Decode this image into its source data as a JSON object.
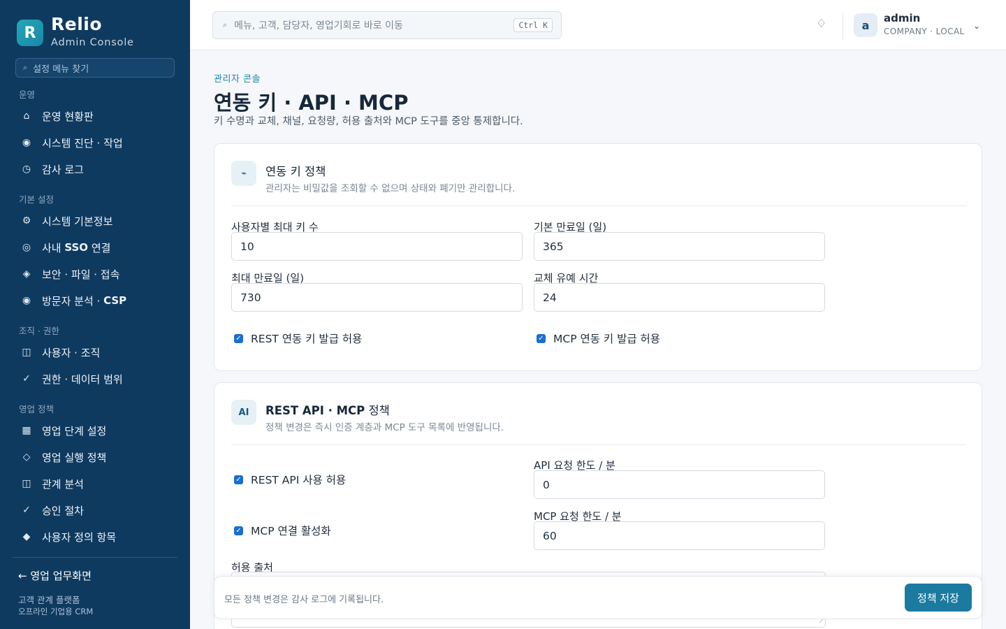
{
  "sidebar": {
    "brand": {
      "logo_letter": "R",
      "name": "Relio",
      "subtitle": "Admin Console"
    },
    "search_placeholder": "설정 메뉴 찾기",
    "groups": [
      {
        "label": "운영"
      },
      {
        "label": "기본 설정"
      },
      {
        "label": "조직 · 권한"
      },
      {
        "label": "영업 정책"
      }
    ],
    "items": [
      {
        "icon": "⌂",
        "icon_name": "home-icon",
        "label": "운영 현황판"
      },
      {
        "icon": "◉",
        "icon_name": "diagnostic-icon",
        "label": "시스템 진단 · 작업"
      },
      {
        "icon": "◷",
        "icon_name": "clock-icon",
        "label": "감사 로그"
      },
      {
        "icon": "⚙",
        "icon_name": "gear-icon",
        "label": "시스템 기본정보"
      },
      {
        "icon": "◎",
        "icon_name": "sso-icon",
        "label_pre": "사내 ",
        "label_bold": "SSO",
        "label_post": " 연결"
      },
      {
        "icon": "◈",
        "icon_name": "shield-icon",
        "label": "보안 · 파일 · 접속"
      },
      {
        "icon": "◉",
        "icon_name": "analytics-icon",
        "label_pre": "방문자 분석 · ",
        "label_bold": "CSP",
        "label_post": ""
      },
      {
        "icon": "◫",
        "icon_name": "users-icon",
        "label": "사용자 · 조직"
      },
      {
        "icon": "✓",
        "icon_name": "check-icon",
        "label": "권한 · 데이터 범위"
      },
      {
        "icon": "▦",
        "icon_name": "grid-icon",
        "label": "영업 단계 설정"
      },
      {
        "icon": "◇",
        "icon_name": "diamond-outline-icon",
        "label": "영업 실행 정책"
      },
      {
        "icon": "◫",
        "icon_name": "relation-icon",
        "label": "관계 분석"
      },
      {
        "icon": "✓",
        "icon_name": "approval-icon",
        "label": "승인 절차"
      },
      {
        "icon": "◆",
        "icon_name": "diamond-filled-icon",
        "label": "사용자 정의 항목"
      }
    ],
    "back_link": "← 영업 업무화면",
    "footer_line1": "고객 관계 플랫폼",
    "footer_line2": "오프라인 기업용 CRM"
  },
  "topbar": {
    "search_placeholder": "메뉴, 고객, 담당자, 영업기회로 바로 이동",
    "shortcut": "Ctrl K",
    "user": {
      "avatar_letter": "a",
      "name": "admin",
      "org": "COMPANY · LOCAL"
    }
  },
  "page": {
    "breadcrumb": "관리자 콘솔",
    "title_plain": "연동 키 · ",
    "title_bold": "API · MCP",
    "description": "키 수명과 교체, 채널, 요청량, 허용 출처와 MCP 도구를 중앙 통제합니다."
  },
  "card_keys": {
    "icon": "⌁",
    "title": "연동 키 정책",
    "subtitle": "관리자는 비밀값을 조회할 수 없으며 상태와 폐기만 관리합니다.",
    "fields": {
      "max_keys": {
        "label": "사용자별 최대 키 수",
        "value": "10"
      },
      "default_expiry": {
        "label": "기본 만료일 (일)",
        "value": "365"
      },
      "max_expiry": {
        "label": "최대 만료일 (일)",
        "value": "730"
      },
      "grace_period": {
        "label": "교체 유예 시간",
        "value": "24"
      }
    },
    "checkboxes": {
      "rest_issue": {
        "label": "REST 연동 키 발급 허용",
        "checked": true
      },
      "mcp_issue": {
        "label": "MCP 연동 키 발급 허용",
        "checked": true
      }
    }
  },
  "card_api": {
    "icon": "AI",
    "title_bold": "REST API · MCP",
    "title_plain": " 정책",
    "subtitle": "정책 변경은 즉시 인증 계층과 MCP 도구 목록에 반영됩니다.",
    "checkboxes": {
      "rest_enabled": {
        "label": "REST API 사용 허용",
        "checked": true
      },
      "mcp_enabled": {
        "label": "MCP 연결 활성화",
        "checked": true
      }
    },
    "fields": {
      "api_rate": {
        "label": "API 요청 한도 / 분",
        "value": "0"
      },
      "mcp_rate": {
        "label": "MCP 요청 한도 / 분",
        "value": "60"
      },
      "allowed_origins": {
        "label": "허용 출처",
        "value": ""
      }
    }
  },
  "savebar": {
    "note": "모든 정책 변경은 감사 로그에 기록됩니다.",
    "save_label": "정책 저장"
  },
  "colors": {
    "sidebar_bg": "#0f3a5f",
    "accent": "#1b7aa0",
    "checkbox": "#1a6fd0"
  }
}
